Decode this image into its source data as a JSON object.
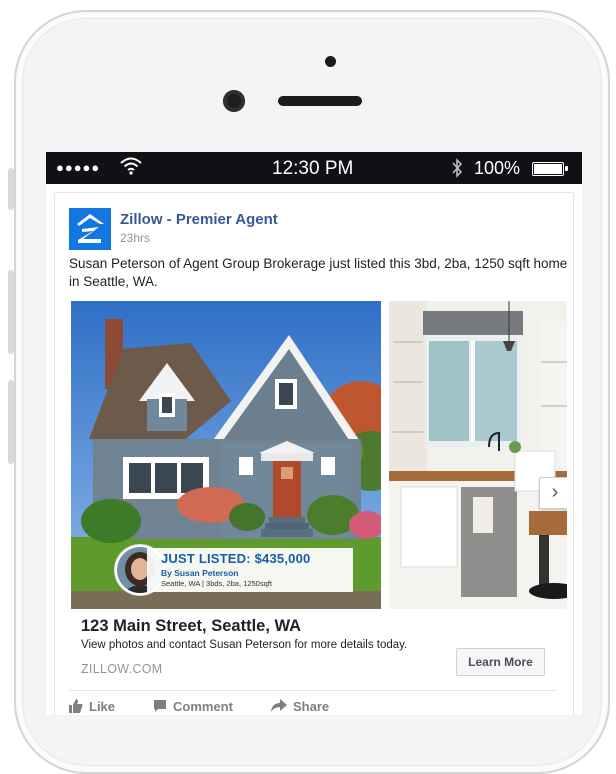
{
  "status_bar": {
    "signal": "●●●●●",
    "time": "12:30 PM",
    "battery": "100%"
  },
  "post": {
    "page_name": "Zillow - Premier Agent",
    "time": "23hrs",
    "text": "Susan Peterson of Agent Group Brokerage just listed this 3bd, 2ba, 1250 sqft home in Seattle, WA."
  },
  "listing_overlay": {
    "title": "JUST LISTED: $435,000",
    "agent": "By Susan Peterson",
    "details": "Seattle, WA | 3bds, 2ba, 1250sqft"
  },
  "link": {
    "headline": "123 Main Street, Seattle, WA",
    "description": "View photos and contact Susan Peterson for more details today.",
    "domain": "ZILLOW.COM",
    "cta": "Learn More"
  },
  "actions": {
    "like": "Like",
    "comment": "Comment",
    "share": "Share"
  },
  "icons": {
    "next": "chevron-right-icon",
    "logo": "zillow-logo",
    "wifi": "wifi-icon",
    "bluetooth": "bluetooth-icon",
    "battery": "battery-icon"
  },
  "colors": {
    "zillow_blue": "#1277e1",
    "facebook_link": "#365899",
    "overlay_blue": "#1b5aa8"
  }
}
